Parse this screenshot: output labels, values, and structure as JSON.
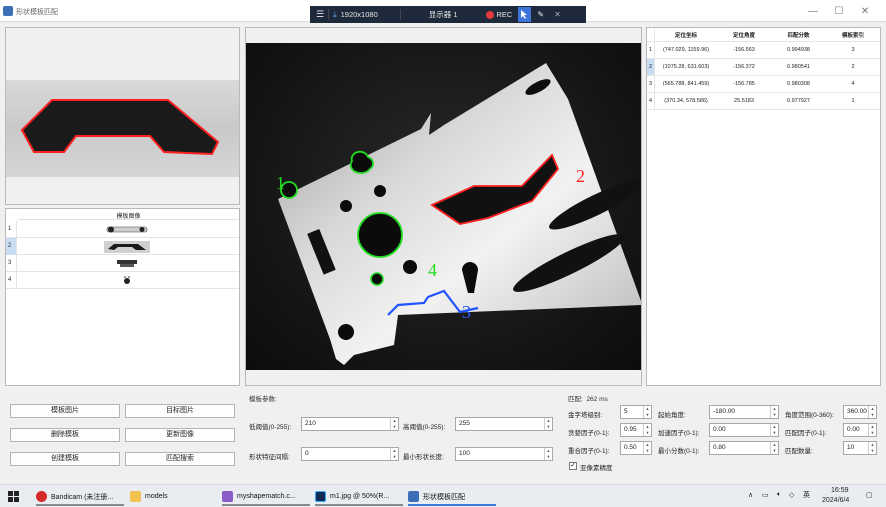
{
  "window": {
    "title": "形状模板匹配",
    "controls": [
      "—",
      "☐",
      "✕"
    ]
  },
  "recorder": {
    "resolution": "1920x1080",
    "display": "显示器 1",
    "rec_label": "REC"
  },
  "template_list": {
    "header": "模板图像",
    "rows": [
      "1",
      "2",
      "3",
      "4"
    ]
  },
  "result_table": {
    "headers": [
      "定位坐标",
      "定位角度",
      "匹配分数",
      "模板索引"
    ],
    "rows": [
      {
        "idx": "1",
        "coord": "(747.029, 1159.96)",
        "angle": "-156.563",
        "score": "0.994938",
        "tpl": "3"
      },
      {
        "idx": "2",
        "coord": "(1075.28, 631.603)",
        "angle": "-156.372",
        "score": "0.980541",
        "tpl": "2"
      },
      {
        "idx": "3",
        "coord": "(565.788, 841.459)",
        "angle": "-156.785",
        "score": "0.980308",
        "tpl": "4"
      },
      {
        "idx": "4",
        "coord": "(370.34, 578.586)",
        "angle": "25.5183",
        "score": "0.977927",
        "tpl": "1"
      }
    ]
  },
  "match_labels": [
    "1",
    "2",
    "3",
    "4"
  ],
  "buttons": {
    "template_image": "模板图片",
    "target_image": "目标图片",
    "delete_template": "删除模板",
    "update_image": "更新图像",
    "create_template": "创建模板",
    "match_search": "匹配搜索"
  },
  "template_params": {
    "section": "模板参数:",
    "low_threshold_label": "低阈值(0-255):",
    "low_threshold": "210",
    "high_threshold_label": "高阈值(0-255):",
    "high_threshold": "255",
    "feature_spacing_label": "形状特征间隔:",
    "feature_spacing": "0",
    "min_length_label": "最小形状长度:",
    "min_length": "100"
  },
  "match_params": {
    "section": "匹配:",
    "time": "262 ms",
    "pyramid_label": "金字塔级别:",
    "pyramid": "5",
    "start_angle_label": "起始角度:",
    "start_angle": "-180.00",
    "angle_range_label": "角度范围(0-360):",
    "angle_range": "360.00",
    "greedy_label": "贪婪因子(0-1):",
    "greedy": "0.95",
    "accel_label": "加速因子(0-1):",
    "accel": "0.00",
    "match_factor_label": "匹配因子(0-1):",
    "match_factor": "0.00",
    "overlap_label": "重合因子(0-1):",
    "overlap": "0.50",
    "min_score_label": "最小分数(0-1):",
    "min_score": "0.80",
    "match_count_label": "匹配数量:",
    "match_count": "10",
    "subpixel_label": "亚像素精度",
    "subpixel_checked": true
  },
  "taskbar": {
    "items": [
      "Bandicam (未注册...",
      "models",
      "myshapematch.c...",
      "m1.jpg @ 50%(R...",
      "形状模板匹配"
    ],
    "ime": "英",
    "time": "16:59",
    "date": "2024/6/4"
  },
  "colors": {
    "match_green": "#22dd22",
    "match_red": "#ff2020",
    "match_blue": "#2255ff",
    "selection": "#c8dcf2"
  }
}
